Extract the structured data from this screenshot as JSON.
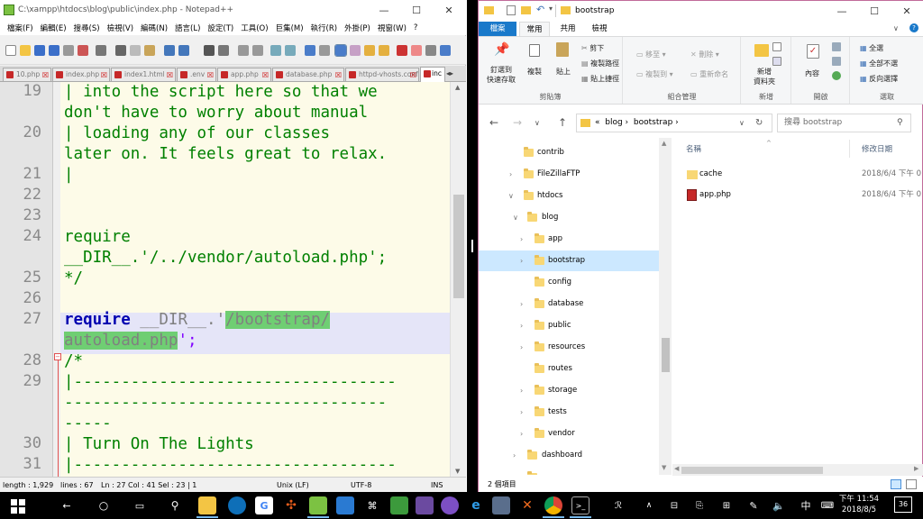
{
  "notepad": {
    "title": "C:\\xampp\\htdocs\\blog\\public\\index.php - Notepad++",
    "menu": [
      "檔案(F)",
      "編輯(E)",
      "搜尋(S)",
      "檢視(V)",
      "編碼(N)",
      "語言(L)",
      "設定(T)",
      "工具(O)",
      "巨集(M)",
      "執行(R)",
      "外掛(P)",
      "視窗(W)",
      "?"
    ],
    "tabs": [
      "10.php",
      "index.php",
      "index1.html",
      ".env",
      "app.php",
      "database.php",
      "httpd-vhosts.conf",
      "inc"
    ],
    "lines": [
      {
        "num": "19",
        "text": [
          "| into the script here so that we",
          "don't have to worry about manual"
        ]
      },
      {
        "num": "20",
        "text": [
          "| loading any of our classes",
          "later on. It feels great to relax.",
          "|"
        ]
      },
      {
        "num": "21"
      },
      {
        "num": "22"
      },
      {
        "num": "23"
      },
      {
        "num": "24",
        "text": [
          "require",
          "__DIR__.'/../vendor/autoload.php';",
          "*/"
        ]
      },
      {
        "num": "25"
      },
      {
        "num": "26"
      },
      {
        "num": "27",
        "kw": "require",
        "dir": " __DIR__.'",
        "hl1": "/bootstrap/",
        "hl2": "autoload.php",
        "end": "';"
      },
      {
        "num": "28",
        "text": [
          "/*"
        ]
      },
      {
        "num": "29",
        "text": [
          "|----------------------------------",
          "----------------------------------",
          "-----"
        ]
      },
      {
        "num": "30",
        "text": [
          "| Turn On The Lights"
        ]
      },
      {
        "num": "31",
        "text": [
          "|----------------------------------"
        ]
      }
    ],
    "status": {
      "length": "length : 1,929",
      "lines": "lines : 67",
      "pos": "Ln : 27    Col : 41    Sel : 23 | 1",
      "eol": "Unix (LF)",
      "enc": "UTF-8",
      "mode": "INS"
    }
  },
  "explorer": {
    "title": "bootstrap",
    "ribbon_tabs": [
      "檔案",
      "常用",
      "共用",
      "檢視"
    ],
    "groups": {
      "clipboard": {
        "label": "剪貼簿",
        "pin": "釘選到\n快速存取",
        "copy": "複製",
        "paste": "貼上",
        "cut": "剪下",
        "copy_path": "複製路徑",
        "paste_shortcut": "貼上捷徑"
      },
      "organize": {
        "label": "組合管理",
        "move": "移至",
        "copyto": "複製到",
        "delete": "刪除",
        "rename": "重新命名"
      },
      "new": {
        "label": "新增",
        "new_folder": "新增\n資料夾"
      },
      "open": {
        "label": "開啟",
        "props": "內容"
      },
      "select": {
        "label": "選取",
        "all": "全選",
        "none": "全部不選",
        "invert": "反向選擇"
      }
    },
    "address": {
      "chev": "«",
      "parts": [
        "blog",
        "bootstrap"
      ]
    },
    "search_placeholder": "搜尋 bootstrap",
    "tree": [
      "contrib",
      "FileZillaFTP",
      "htdocs",
      "blog",
      "app",
      "bootstrap",
      "config",
      "database",
      "public",
      "resources",
      "routes",
      "storage",
      "tests",
      "vendor",
      "dashboard"
    ],
    "columns": {
      "name": "名稱",
      "date": "修改日期"
    },
    "files": [
      {
        "name": "cache",
        "date": "2018/6/4 下午 0"
      },
      {
        "name": "app.php",
        "date": "2018/6/4 下午 0"
      }
    ],
    "status": "2 個項目"
  },
  "taskbar": {
    "time": "下午 11:54",
    "date": "2018/8/5",
    "lang": "中",
    "notif": "36"
  }
}
